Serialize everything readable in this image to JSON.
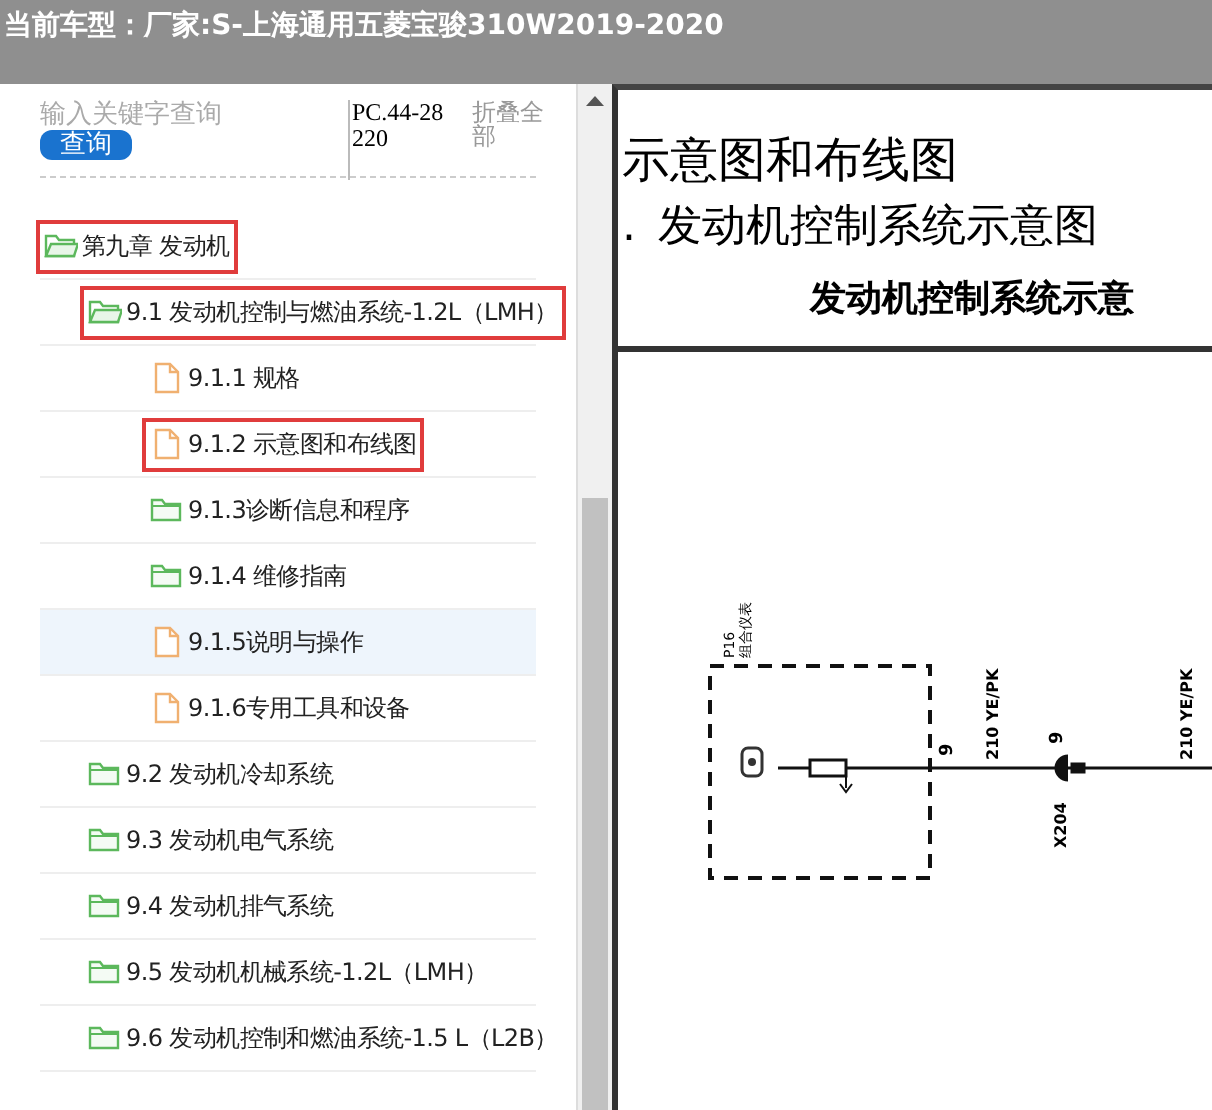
{
  "title_bar": {
    "label": "当前车型：",
    "value": "厂家:S-上海通用五菱宝骏310W2019-2020"
  },
  "search": {
    "placeholder": "输入关键字查询",
    "button": "查询"
  },
  "doc_code": "PC.44-28220",
  "collapse_all": "折叠全部",
  "tree": [
    {
      "label": "第九章 发动机",
      "kind": "folder",
      "expanded": true,
      "outlined": true,
      "selected": false,
      "children": [
        {
          "label": "9.1 发动机控制与燃油系统-1.2L（LMH）",
          "kind": "folder",
          "expanded": true,
          "outlined": true,
          "selected": false,
          "children": [
            {
              "label": "9.1.1 规格",
              "kind": "file",
              "outlined": false,
              "selected": false
            },
            {
              "label": "9.1.2 示意图和布线图",
              "kind": "file",
              "outlined": true,
              "selected": false
            },
            {
              "label": "9.1.3诊断信息和程序",
              "kind": "folder",
              "expanded": false,
              "outlined": false,
              "selected": false
            },
            {
              "label": "9.1.4 维修指南",
              "kind": "folder",
              "expanded": false,
              "outlined": false,
              "selected": false
            },
            {
              "label": "9.1.5说明与操作",
              "kind": "file",
              "outlined": false,
              "selected": true
            },
            {
              "label": "9.1.6专用工具和设备",
              "kind": "file",
              "outlined": false,
              "selected": false
            }
          ]
        },
        {
          "label": "9.2 发动机冷却系统",
          "kind": "folder",
          "expanded": false,
          "outlined": false,
          "selected": false
        },
        {
          "label": "9.3 发动机电气系统",
          "kind": "folder",
          "expanded": false,
          "outlined": false,
          "selected": false
        },
        {
          "label": "9.4 发动机排气系统",
          "kind": "folder",
          "expanded": false,
          "outlined": false,
          "selected": false
        },
        {
          "label": "9.5 发动机机械系统-1.2L（LMH）",
          "kind": "folder",
          "expanded": false,
          "outlined": false,
          "selected": false
        },
        {
          "label": "9.6 发动机控制和燃油系统-1.5 L（L2B）",
          "kind": "folder",
          "expanded": false,
          "outlined": false,
          "selected": false
        }
      ]
    }
  ],
  "document": {
    "heading": "示意图和布线图",
    "subheading_mark": ".",
    "subheading": "发动机控制系统示意图",
    "diagram_title": "发动机控制系统示意",
    "diagram": {
      "component_code": "P16",
      "component_name": "组合仪表",
      "pin_a": "9",
      "wire_a": "210 YE/PK",
      "pin_b": "9",
      "connector": "X204",
      "wire_b": "210 YE/PK"
    }
  }
}
